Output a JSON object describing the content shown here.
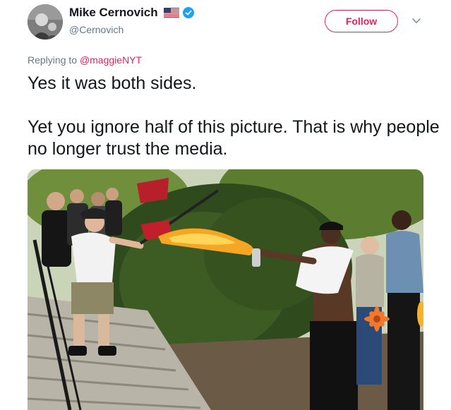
{
  "author": {
    "name": "Mike Cernovich",
    "handle": "@Cernovich",
    "flag_icon": "us-flag-icon",
    "verified_icon": "verified-badge-icon"
  },
  "actions": {
    "follow_label": "Follow",
    "menu_icon": "chevron-down-icon"
  },
  "reply": {
    "prefix": "Replying to ",
    "mention": "@maggieNYT"
  },
  "tweet": {
    "line1": "Yes it was both sides.",
    "line2": "Yet you ignore half of this picture. That is why people no longer trust the media."
  },
  "media": {
    "type": "photo"
  },
  "colors": {
    "accent": "#e0245e",
    "verified": "#1da1f2",
    "secondary_text": "#657786",
    "primary_text": "#14171a"
  }
}
